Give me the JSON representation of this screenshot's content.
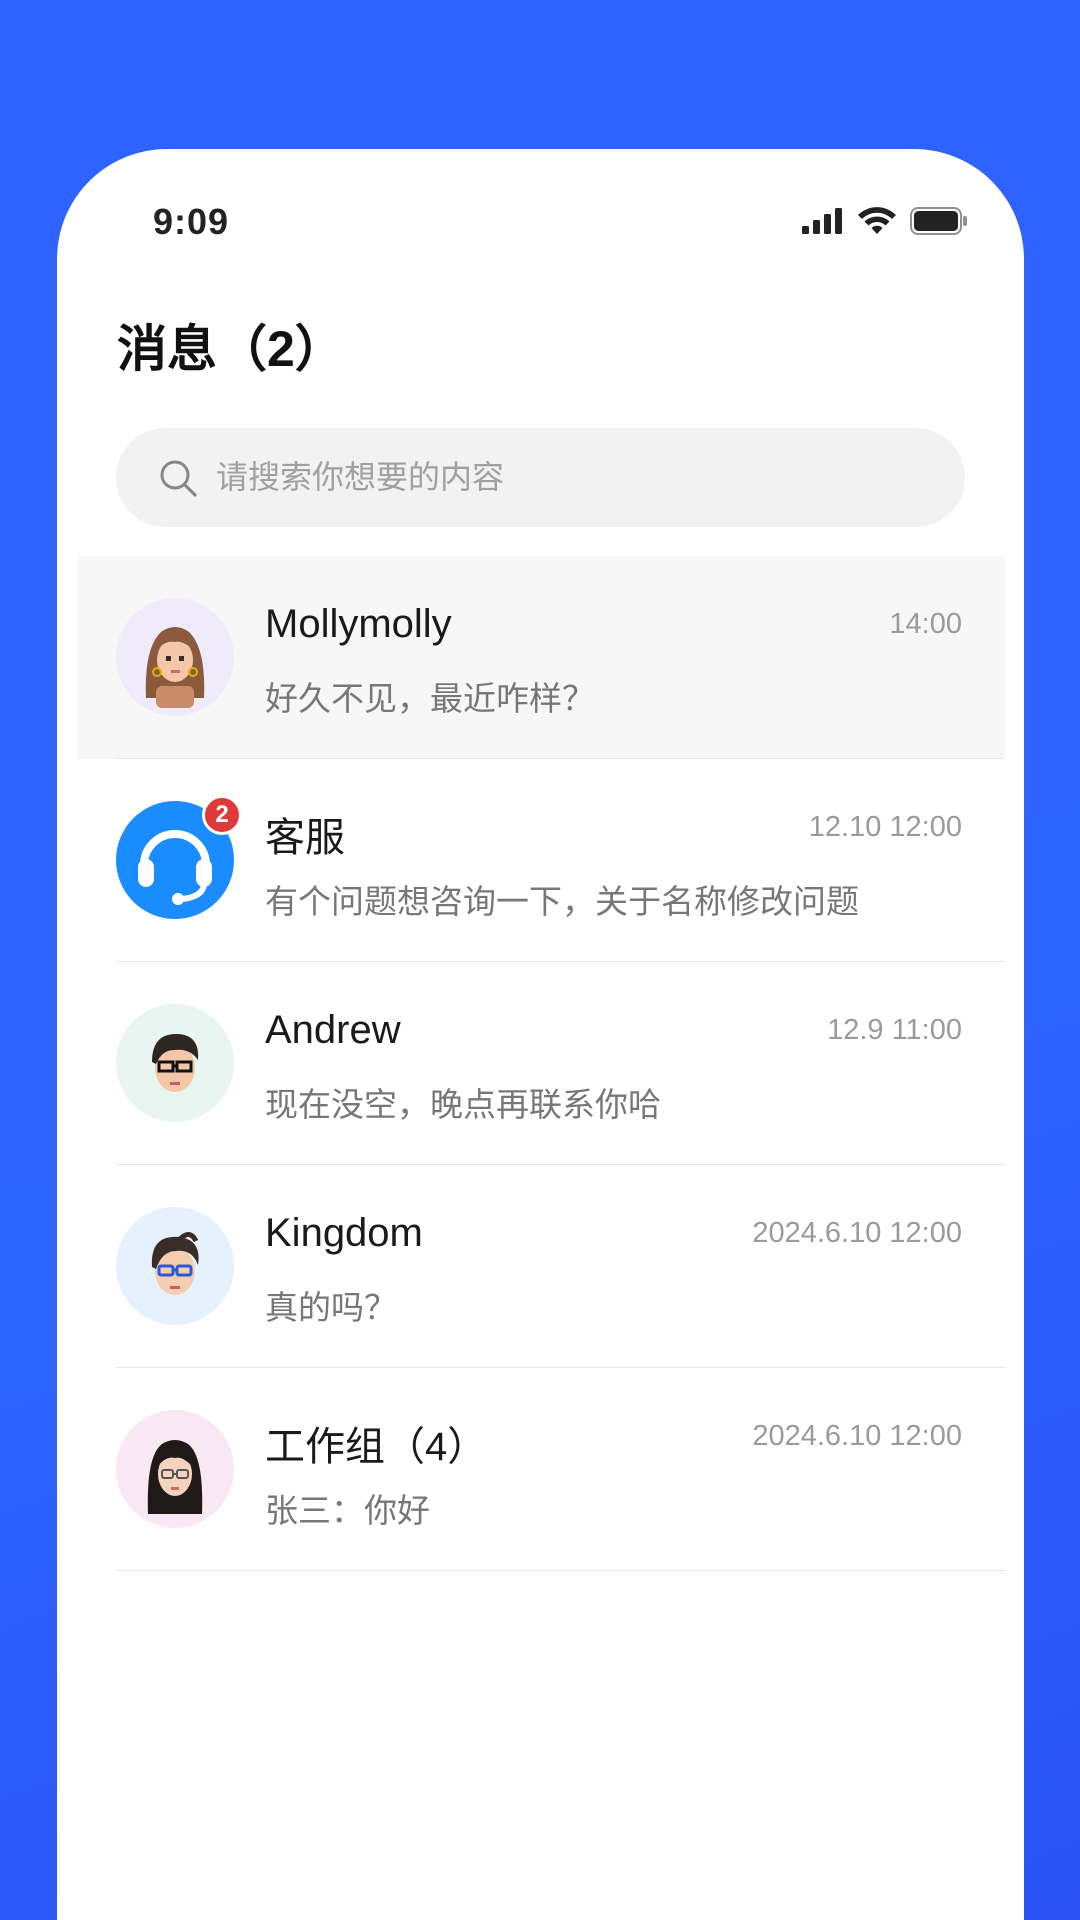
{
  "status_bar": {
    "time": "9:09",
    "icons": [
      "signal-icon",
      "wifi-icon",
      "battery-icon"
    ]
  },
  "page": {
    "title": "消息（2）"
  },
  "search": {
    "placeholder": "请搜索你想要的内容",
    "icon": "search-icon"
  },
  "conversations": [
    {
      "name": "Mollymolly",
      "time": "14:00",
      "preview": "好久不见，最近咋样？",
      "avatar": "avatar-woman-long-hair",
      "highlighted": true
    },
    {
      "name": "客服",
      "time": "12.10 12:00",
      "preview": "有个问题想咨询一下，关于名称修改问题",
      "avatar": "headset-icon",
      "badge": "2"
    },
    {
      "name": "Andrew",
      "time": "12.9 11:00",
      "preview": "现在没空，晚点再联系你哈",
      "avatar": "avatar-man-glasses"
    },
    {
      "name": "Kingdom",
      "time": "2024.6.10 12:00",
      "preview": "真的吗？",
      "avatar": "avatar-man-blue-glasses"
    },
    {
      "name": "工作组（4）",
      "time": "2024.6.10 12:00",
      "preview": "张三：你好",
      "avatar": "avatar-woman-glasses"
    }
  ],
  "colors": {
    "background": "#2d63ff",
    "accent": "#1a8cff",
    "badge": "#e0393b"
  }
}
